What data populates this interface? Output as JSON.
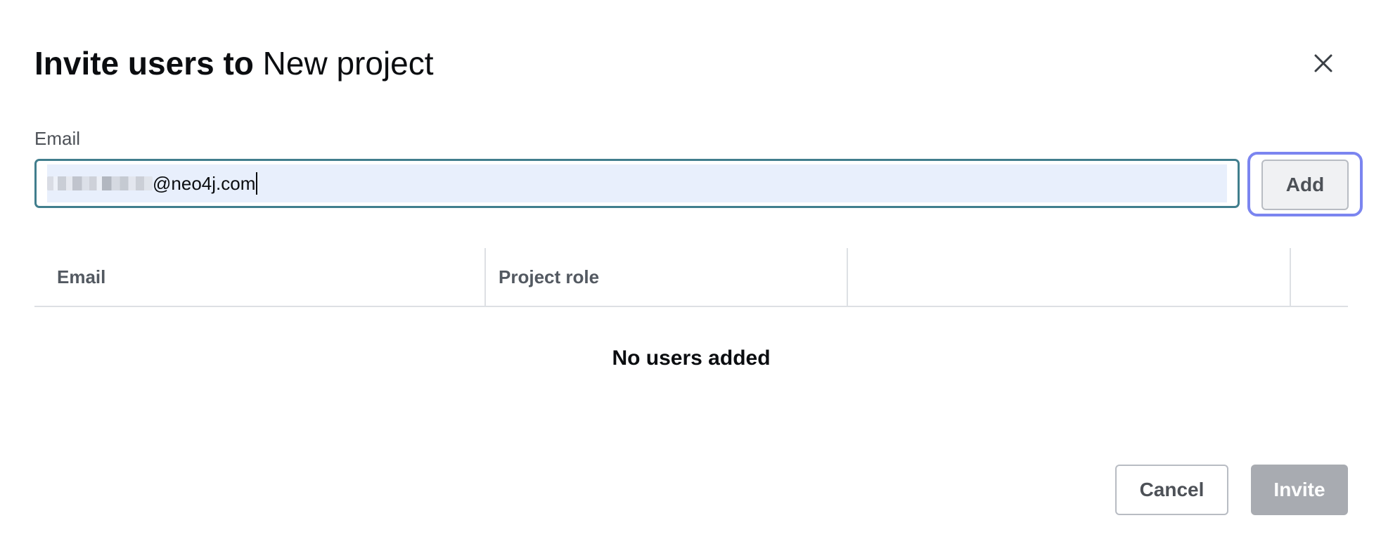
{
  "dialog": {
    "title_strong": "Invite users to",
    "title_project": "New project",
    "close_icon": "close-icon"
  },
  "email_field": {
    "label": "Email",
    "value_visible_suffix": "@neo4j.com",
    "value_prefix_redacted": true,
    "focused": true
  },
  "add_button": {
    "label": "Add",
    "focused": true
  },
  "users_table": {
    "columns": [
      "Email",
      "Project role",
      ""
    ],
    "rows": [],
    "empty_message": "No users added"
  },
  "footer": {
    "cancel_label": "Cancel",
    "invite_label": "Invite",
    "invite_disabled": true
  },
  "colors": {
    "input_border": "#417e8d",
    "input_fill": "#e8effc",
    "focus_ring": "#7b85f0",
    "disabled_button": "#a8abb1",
    "header_text": "#535961"
  }
}
